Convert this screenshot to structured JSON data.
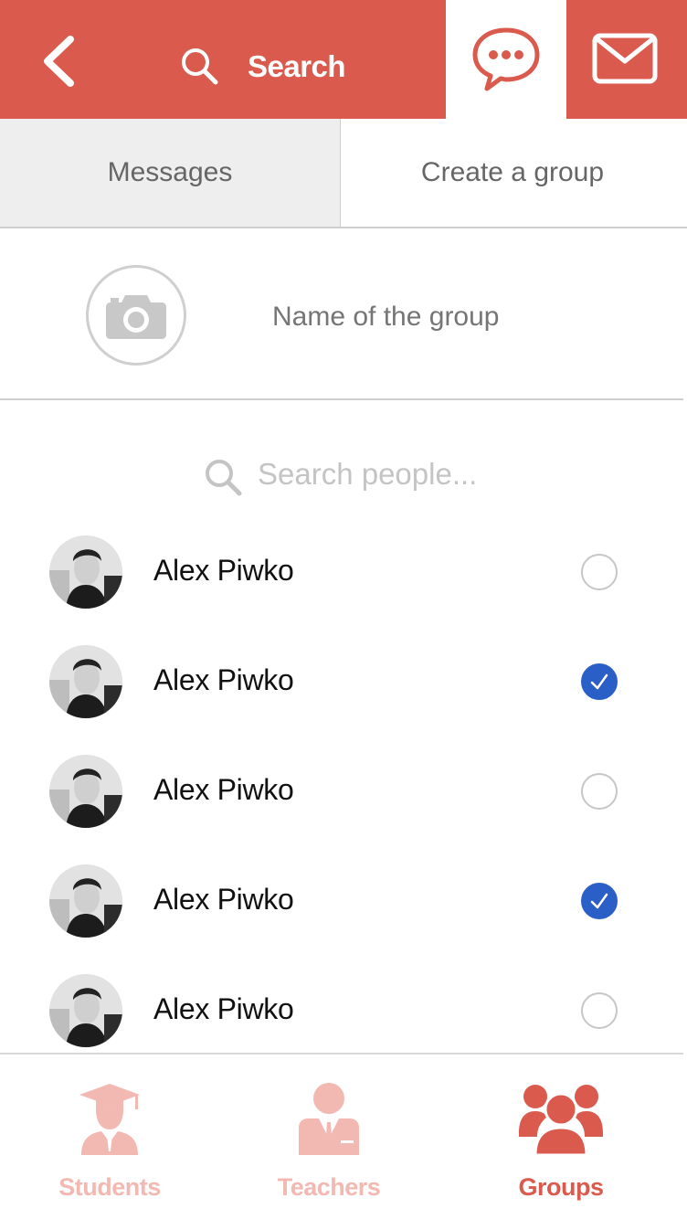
{
  "colors": {
    "brand_red": "#da5a4d",
    "faded_red": "#f2b8b2",
    "check_blue": "#2a5fc8",
    "placeholder_gray": "#c4c4c4"
  },
  "header": {
    "back_icon": "chevron-left-icon",
    "search_label": "Search",
    "search_icon": "search-icon",
    "chat_icon": "chat-bubble-icon",
    "mail_icon": "envelope-icon"
  },
  "tabs": [
    {
      "label": "Messages",
      "active": false
    },
    {
      "label": "Create a group",
      "active": true
    }
  ],
  "group_form": {
    "camera_icon": "camera-icon",
    "name_placeholder": "Name of the group",
    "name_value": ""
  },
  "people_search": {
    "placeholder": "Search people..."
  },
  "people": [
    {
      "name": "Alex Piwko",
      "selected": false
    },
    {
      "name": "Alex Piwko",
      "selected": true
    },
    {
      "name": "Alex Piwko",
      "selected": false
    },
    {
      "name": "Alex Piwko",
      "selected": true
    },
    {
      "name": "Alex Piwko",
      "selected": false
    }
  ],
  "bottom_nav": [
    {
      "label": "Students",
      "icon": "graduate-icon",
      "active": false
    },
    {
      "label": "Teachers",
      "icon": "teacher-icon",
      "active": false
    },
    {
      "label": "Groups",
      "icon": "group-icon",
      "active": true
    }
  ]
}
